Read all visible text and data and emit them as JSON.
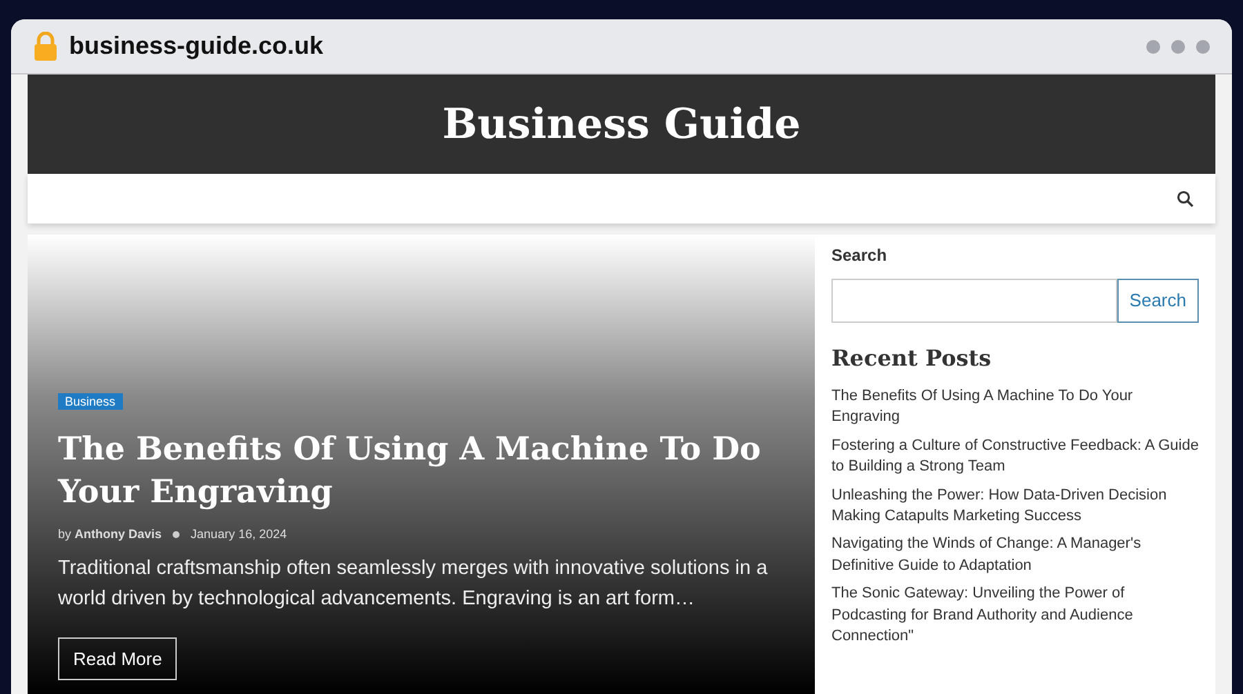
{
  "browser": {
    "url": "business-guide.co.uk"
  },
  "site": {
    "title": "Business Guide"
  },
  "featured": {
    "category": "Business",
    "title": "The Benefits Of Using A Machine To Do Your Engraving",
    "by": "by",
    "author": "Anthony Davis",
    "date": "January 16, 2024",
    "excerpt": "Traditional craftsmanship often seamlessly merges with innovative solutions in a world driven by technological advancements. Engraving is an art form…",
    "button": "Read More"
  },
  "sidebar": {
    "search_label": "Search",
    "search_button": "Search",
    "recent_title": "Recent Posts",
    "recent_posts": [
      {
        "title": "The Benefits Of Using A Machine To Do Your Engraving"
      },
      {
        "title": "Fostering a Culture of Constructive Feedback: A Guide to Building a Strong Team"
      },
      {
        "title": "Unleashing the Power: How Data-Driven Decision Making Catapults Marketing Success"
      },
      {
        "title": "Navigating the Winds of Change: A Manager's Definitive Guide to Adaptation"
      },
      {
        "title": "The Sonic Gateway: Unveiling the Power of Podcasting for Brand Authority and Audience Connection\""
      }
    ]
  }
}
